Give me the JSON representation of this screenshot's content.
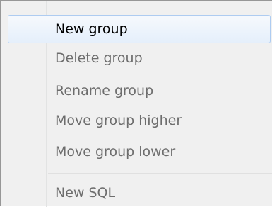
{
  "context_menu": {
    "items": [
      {
        "label": "New group"
      },
      {
        "label": "Delete group"
      },
      {
        "label": "Rename group"
      },
      {
        "label": "Move group higher"
      },
      {
        "label": "Move group lower"
      },
      {
        "label": "New SQL"
      }
    ]
  }
}
